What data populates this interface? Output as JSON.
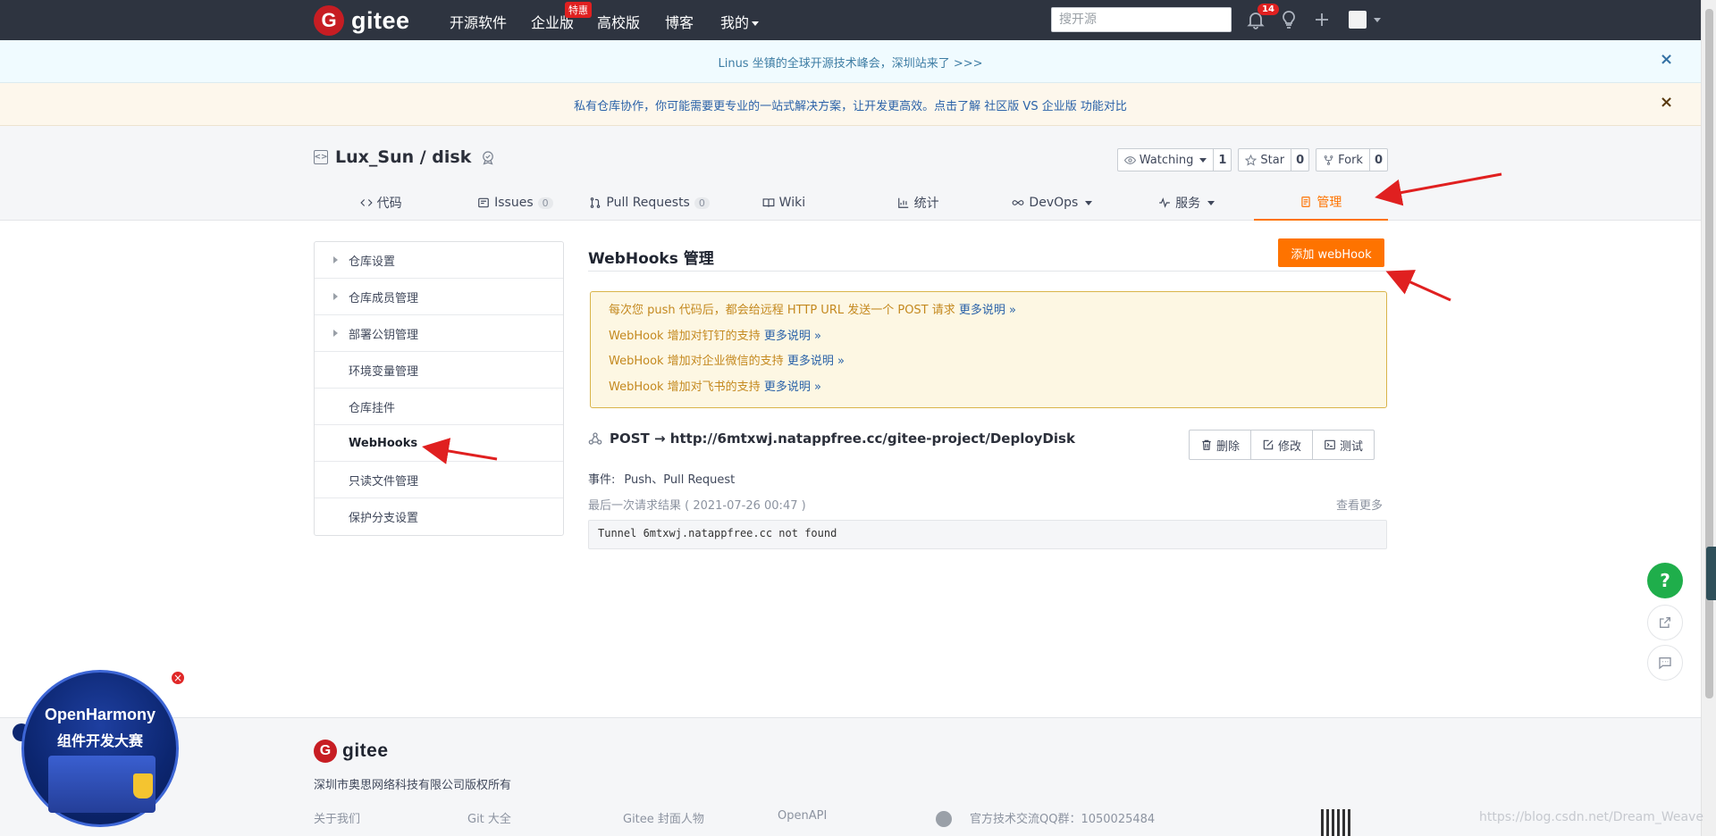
{
  "topnav": {
    "logo_text": "gitee",
    "logo_mark": "G",
    "items": [
      {
        "label": "开源软件"
      },
      {
        "label": "企业版"
      },
      {
        "label": "高校版"
      },
      {
        "label": "博客"
      },
      {
        "label": "我的"
      }
    ],
    "enterprise_badge": "特惠",
    "search_placeholder": "搜开源",
    "notification_count": "14",
    "icons": [
      "bell-icon",
      "lightbulb-icon",
      "plus-icon",
      "avatar"
    ]
  },
  "banners": {
    "conference": "Linus 坐镇的全球开源技术峰会，深圳站来了 >>>",
    "private_repo": "私有仓库协作，你可能需要更专业的一站式解决方案，让开发更高效。点击了解 社区版 VS 企业版 功能对比",
    "close": "×"
  },
  "project": {
    "title": "Lux_Sun / disk",
    "watch_label": "Watching",
    "watch_count": "1",
    "star_label": "Star",
    "star_count": "0",
    "fork_label": "Fork",
    "fork_count": "0",
    "tabs": [
      {
        "label": "代码",
        "icon": "code-icon"
      },
      {
        "label": "Issues",
        "count": "0",
        "icon": "issues-icon"
      },
      {
        "label": "Pull Requests",
        "count": "0",
        "icon": "pull-request-icon"
      },
      {
        "label": "Wiki",
        "icon": "book-icon"
      },
      {
        "label": "统计",
        "icon": "chart-icon"
      },
      {
        "label": "DevOps",
        "icon": "infinity-icon"
      },
      {
        "label": "服务",
        "icon": "pulse-icon"
      },
      {
        "label": "管理",
        "icon": "settings-doc-icon"
      }
    ]
  },
  "sidebar": {
    "items": [
      {
        "label": "仓库设置"
      },
      {
        "label": "仓库成员管理"
      },
      {
        "label": "部署公钥管理"
      },
      {
        "label": "环境变量管理"
      },
      {
        "label": "仓库挂件"
      },
      {
        "label": "WebHooks"
      },
      {
        "label": "只读文件管理"
      },
      {
        "label": "保护分支设置"
      }
    ]
  },
  "main": {
    "title": "WebHooks 管理",
    "add_button": "添加 webHook",
    "info_lines": [
      {
        "text": "每次您 push 代码后，都会给远程 HTTP URL 发送一个 POST 请求 ",
        "more": "更多说明 »"
      },
      {
        "text": "WebHook 增加对钉钉的支持 ",
        "more": "更多说明 »"
      },
      {
        "text": "WebHook 增加对企业微信的支持 ",
        "more": "更多说明 »"
      },
      {
        "text": "WebHook 增加对飞书的支持 ",
        "more": "更多说明 »"
      }
    ],
    "hook": {
      "url": "POST → http://6mtxwj.natappfree.cc/gitee-project/DeployDisk",
      "delete": "删除",
      "edit": "修改",
      "test": "测试",
      "events_key": "事件:",
      "events_value": "Push、Pull Request",
      "last_result": "最后一次请求结果 ( 2021-07-26 00:47 )",
      "view_more": "查看更多",
      "result": "Tunnel 6mtxwj.natappfree.cc not found"
    }
  },
  "floating": {
    "help": "?"
  },
  "footer": {
    "logo_text": "gitee",
    "copyright": "深圳市奥思网络科技有限公司版权所有",
    "links": [
      "关于我们",
      "Git 大全",
      "Gitee 封面人物",
      "OpenAPI"
    ],
    "qq_group": "官方技术交流QQ群：1050025484",
    "watermark": "https://blog.csdn.net/Dream_Weave"
  },
  "promo": {
    "title": "OpenHarmony",
    "subtitle": "组件开发大赛",
    "close": "×"
  },
  "colors": {
    "nav_bg": "#2e3440",
    "accent": "#fe7300",
    "brand_red": "#c71d23",
    "link": "#2a62a8",
    "info_text": "#c4891f",
    "help_green": "#1fae4b"
  }
}
